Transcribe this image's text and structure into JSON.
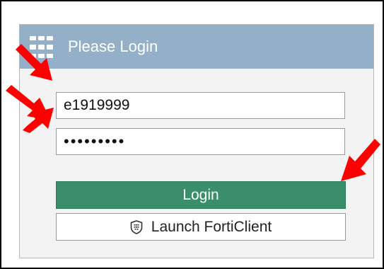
{
  "panel": {
    "title": "Please Login"
  },
  "form": {
    "username_value": "e1919999",
    "password_value": "•••••••••",
    "login_label": "Login",
    "forticlient_label": "Launch FortiClient"
  },
  "colors": {
    "header_bg": "#93b0c8",
    "login_button_bg": "#3a8f6a",
    "annotation_arrow": "#ff0000"
  },
  "icons": {
    "logo": "fortinet-logo-icon",
    "forticlient": "forticlient-shield-icon",
    "annotation": "red-arrow-icon"
  }
}
